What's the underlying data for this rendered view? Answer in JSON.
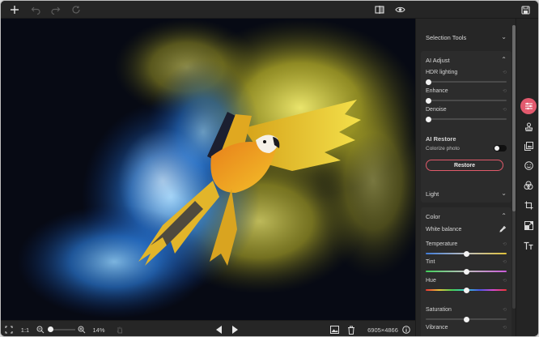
{
  "panel": {
    "selection_tools": "Selection Tools",
    "ai_adjust": {
      "title": "AI Adjust",
      "hdr_lighting": "HDR lighting",
      "enhance": "Enhance",
      "denoise": "Denoise"
    },
    "ai_restore": {
      "title": "AI Restore",
      "colorize_photo": "Colorize photo",
      "restore_button": "Restore"
    },
    "light": "Light",
    "color": {
      "title": "Color",
      "white_balance": "White balance",
      "temperature": "Temperature",
      "tint": "Tint",
      "hue": "Hue",
      "saturation": "Saturation",
      "vibrance": "Vibrance"
    }
  },
  "bottombar": {
    "ratio_label": "1:1",
    "zoom_level": "14%",
    "dimensions": "6905×4866"
  },
  "sliders": {
    "hdr_lighting": 0,
    "enhance": 0,
    "denoise": 0,
    "temperature": 0.5,
    "tint": 0.5,
    "hue": 0.5,
    "saturation": 0.5
  },
  "colors": {
    "accent": "#e35a6e",
    "panel_bg": "#262626",
    "canvas_bg": "#0a0d18"
  },
  "icons": {
    "topbar": [
      "plus-icon",
      "undo-icon",
      "redo-icon",
      "reset-icon",
      "compare-icon",
      "eye-icon",
      "save-icon"
    ],
    "rail": [
      "sliders-icon",
      "stamp-icon",
      "image-layers-icon",
      "face-icon",
      "color-circles-icon",
      "crop-icon",
      "resize-icon",
      "text-icon"
    ]
  }
}
